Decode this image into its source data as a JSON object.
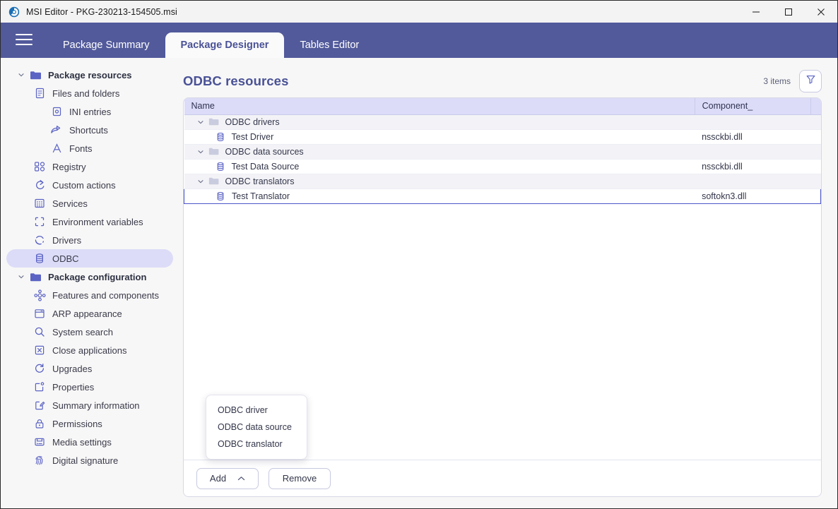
{
  "window": {
    "title": "MSI Editor - PKG-230213-154505.msi",
    "app_icon": "msi-editor-logo",
    "controls": {
      "minimize": "minimize",
      "maximize": "maximize",
      "close": "close"
    }
  },
  "tabbar": {
    "menu_icon": "hamburger-menu-icon",
    "tabs": [
      {
        "label": "Package Summary",
        "active": false
      },
      {
        "label": "Package Designer",
        "active": true
      },
      {
        "label": "Tables Editor",
        "active": false
      }
    ]
  },
  "sidebar": {
    "items": [
      {
        "label": "Package resources",
        "icon": "folder-icon",
        "level": 0,
        "chevron": "chevron-down",
        "group": true,
        "selected": false
      },
      {
        "label": "Files and folders",
        "icon": "document-icon",
        "level": 1,
        "chevron": "",
        "group": false,
        "selected": false
      },
      {
        "label": "INI entries",
        "icon": "ini-entry-icon",
        "level": 2,
        "chevron": "",
        "group": false,
        "selected": false
      },
      {
        "label": "Shortcuts",
        "icon": "shortcut-icon",
        "level": 2,
        "chevron": "",
        "group": false,
        "selected": false
      },
      {
        "label": "Fonts",
        "icon": "font-icon",
        "level": 2,
        "chevron": "",
        "group": false,
        "selected": false
      },
      {
        "label": "Registry",
        "icon": "registry-icon",
        "level": 1,
        "chevron": "",
        "group": false,
        "selected": false
      },
      {
        "label": "Custom actions",
        "icon": "custom-action-icon",
        "level": 1,
        "chevron": "",
        "group": false,
        "selected": false
      },
      {
        "label": "Services",
        "icon": "services-icon",
        "level": 1,
        "chevron": "",
        "group": false,
        "selected": false
      },
      {
        "label": "Environment variables",
        "icon": "environment-icon",
        "level": 1,
        "chevron": "",
        "group": false,
        "selected": false
      },
      {
        "label": "Drivers",
        "icon": "drivers-icon",
        "level": 1,
        "chevron": "",
        "group": false,
        "selected": false
      },
      {
        "label": "ODBC",
        "icon": "odbc-icon",
        "level": 1,
        "chevron": "",
        "group": false,
        "selected": true
      },
      {
        "label": "Package configuration",
        "icon": "folder-icon",
        "level": 0,
        "chevron": "chevron-down",
        "group": true,
        "selected": false
      },
      {
        "label": "Features and components",
        "icon": "features-icon",
        "level": 1,
        "chevron": "",
        "group": false,
        "selected": false
      },
      {
        "label": "ARP appearance",
        "icon": "arp-icon",
        "level": 1,
        "chevron": "",
        "group": false,
        "selected": false
      },
      {
        "label": "System search",
        "icon": "search-icon",
        "level": 1,
        "chevron": "",
        "group": false,
        "selected": false
      },
      {
        "label": "Close applications",
        "icon": "close-apps-icon",
        "level": 1,
        "chevron": "",
        "group": false,
        "selected": false
      },
      {
        "label": "Upgrades",
        "icon": "upgrades-icon",
        "level": 1,
        "chevron": "",
        "group": false,
        "selected": false
      },
      {
        "label": "Properties",
        "icon": "properties-icon",
        "level": 1,
        "chevron": "",
        "group": false,
        "selected": false
      },
      {
        "label": "Summary information",
        "icon": "summary-info-icon",
        "level": 1,
        "chevron": "",
        "group": false,
        "selected": false
      },
      {
        "label": "Permissions",
        "icon": "lock-icon",
        "level": 1,
        "chevron": "",
        "group": false,
        "selected": false
      },
      {
        "label": "Media settings",
        "icon": "media-icon",
        "level": 1,
        "chevron": "",
        "group": false,
        "selected": false
      },
      {
        "label": "Digital signature",
        "icon": "fingerprint-icon",
        "level": 1,
        "chevron": "",
        "group": false,
        "selected": false
      }
    ]
  },
  "main": {
    "title": "ODBC resources",
    "item_count": "3 items",
    "filter_icon": "filter-funnel-icon",
    "table": {
      "columns": [
        "Name",
        "Component_",
        ""
      ],
      "rows": [
        {
          "name": "ODBC drivers",
          "component": "",
          "type": "group",
          "icon": "folder-icon",
          "chevron": "chevron-down",
          "selected": false
        },
        {
          "name": "Test Driver",
          "component": "nssckbi.dll",
          "type": "leaf",
          "icon": "database-icon",
          "chevron": "",
          "selected": false
        },
        {
          "name": "ODBC data sources",
          "component": "",
          "type": "group",
          "icon": "folder-icon",
          "chevron": "chevron-down",
          "selected": false
        },
        {
          "name": "Test Data Source",
          "component": "nssckbi.dll",
          "type": "leaf",
          "icon": "database-icon",
          "chevron": "",
          "selected": false
        },
        {
          "name": "ODBC translators",
          "component": "",
          "type": "group",
          "icon": "folder-icon",
          "chevron": "chevron-down",
          "selected": false
        },
        {
          "name": "Test Translator",
          "component": "softokn3.dll",
          "type": "leaf",
          "icon": "database-icon",
          "chevron": "",
          "selected": true
        }
      ]
    },
    "toolbar": {
      "add_label": "Add",
      "add_caret": "chevron-up-icon",
      "remove_label": "Remove"
    },
    "add_menu": {
      "open": true,
      "items": [
        "ODBC driver",
        "ODBC data source",
        "ODBC translator"
      ]
    }
  },
  "colors": {
    "brand": "#525a9b",
    "accent": "#4a5296",
    "header_row": "#dcdcf8",
    "selection": "#dcdcf8",
    "focus_border": "#4a55c9",
    "icon": "#5b63c4"
  }
}
